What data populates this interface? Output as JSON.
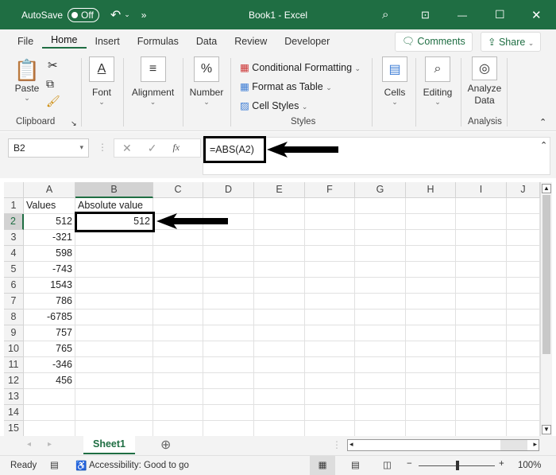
{
  "titlebar": {
    "autosave": "AutoSave",
    "toggle": "Off",
    "title": "Book1  -  Excel"
  },
  "tabs": [
    "File",
    "Home",
    "Insert",
    "Formulas",
    "Data",
    "Review",
    "Developer"
  ],
  "comments": "Comments",
  "share": "Share",
  "ribbon": {
    "paste": "Paste",
    "clipboard": "Clipboard",
    "font": "Font",
    "alignment": "Alignment",
    "number": "Number",
    "cond": "Conditional Formatting",
    "fmt_table": "Format as Table",
    "cell_styles": "Cell Styles",
    "styles": "Styles",
    "cells": "Cells",
    "editing": "Editing",
    "analyze1": "Analyze",
    "analyze2": "Data",
    "analysis": "Analysis"
  },
  "formula_bar": {
    "name_box": "B2",
    "fx": "fx",
    "formula": "=ABS(A2)"
  },
  "columns": [
    "A",
    "B",
    "C",
    "D",
    "E",
    "F",
    "G",
    "H",
    "I",
    "J"
  ],
  "rows": [
    [
      "Values",
      "Absolute value"
    ],
    [
      "512",
      "512"
    ],
    [
      "-321",
      ""
    ],
    [
      "598",
      ""
    ],
    [
      "-743",
      ""
    ],
    [
      "1543",
      ""
    ],
    [
      "786",
      ""
    ],
    [
      "-6785",
      ""
    ],
    [
      "757",
      ""
    ],
    [
      "765",
      ""
    ],
    [
      "-346",
      ""
    ],
    [
      "456",
      ""
    ],
    [
      "",
      ""
    ],
    [
      "",
      ""
    ],
    [
      "",
      ""
    ]
  ],
  "sheet_tab": "Sheet1",
  "status": {
    "ready": "Ready",
    "accessibility": "Accessibility: Good to go",
    "zoom": "100%"
  },
  "colors": {
    "accent": "#1f6e43"
  }
}
